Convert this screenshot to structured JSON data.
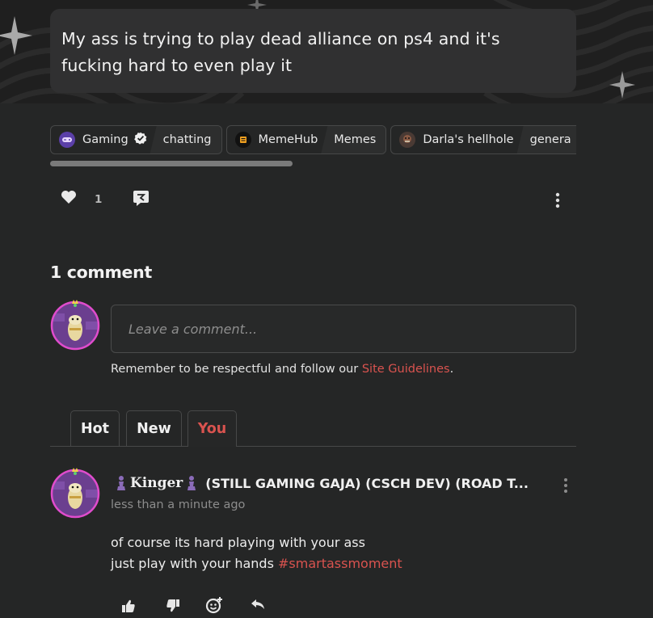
{
  "post": {
    "title": "My ass is trying to play dead alliance on ps4 and it's\nfucking hard to even play it",
    "like_count": "1"
  },
  "tags": [
    {
      "community": "Gaming",
      "icon": "gamepad-icon",
      "verified": true,
      "sub": "chatting"
    },
    {
      "community": "MemeHub",
      "icon": "memehub-icon",
      "verified": false,
      "sub": "Memes"
    },
    {
      "community": "Darla's hellhole",
      "icon": "darla-avatar-icon",
      "verified": false,
      "sub": "genera"
    }
  ],
  "comments": {
    "title": "1 comment",
    "placeholder": "Leave a comment...",
    "guidelines_text": "Remember to be respectful and follow our ",
    "guidelines_link": "Site Guidelines",
    "guidelines_end": ".",
    "sort_tabs": [
      "Hot",
      "New",
      "You"
    ],
    "active_tab": "You"
  },
  "comment": {
    "username": "Kinger",
    "flair": "(STILL GAMING GAJA) (CSCH DEV) (ROAD T...",
    "time": "less than a minute ago",
    "body_line1": "of course its hard playing with your ass",
    "body_line2": "just play with your hands ",
    "hashtag": "#smartassmoment"
  },
  "colors": {
    "background": "#252626",
    "card": "#303031",
    "accent_red": "#d9534f",
    "muted": "#8c8c8c"
  }
}
